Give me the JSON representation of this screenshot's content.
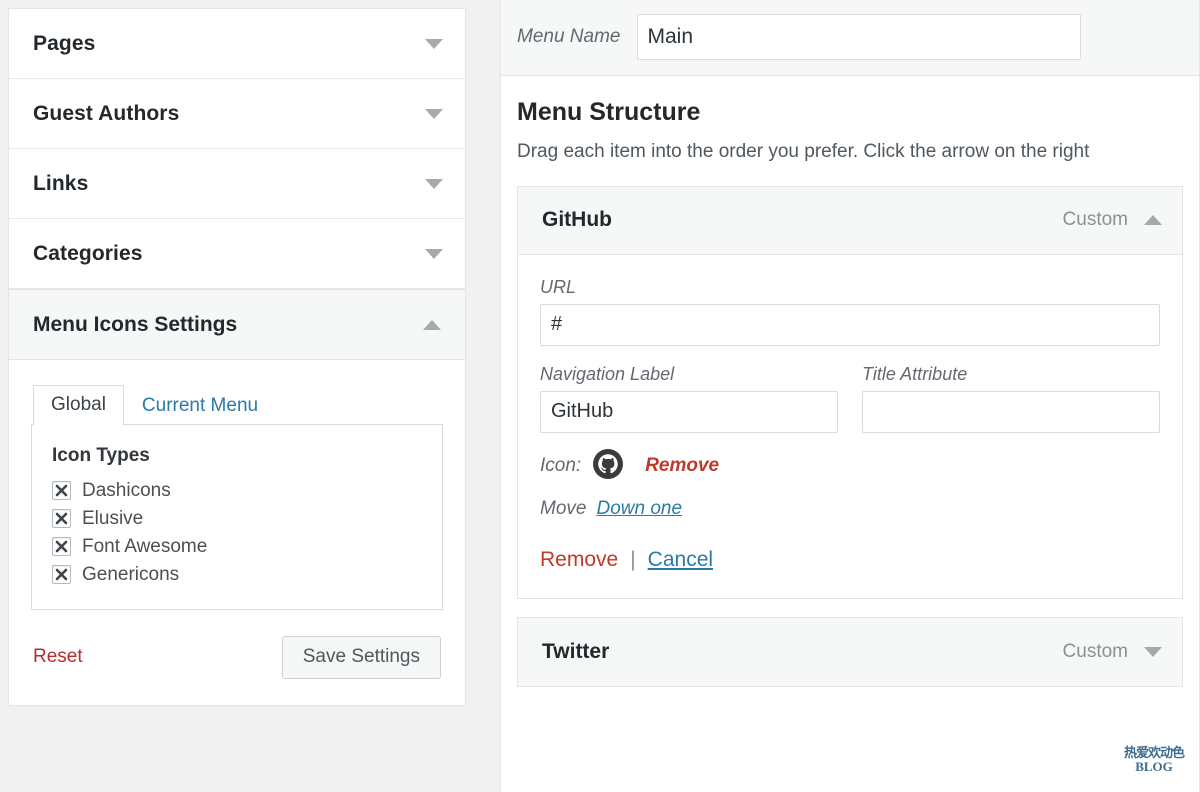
{
  "sidebar": {
    "accordions": [
      {
        "label": "Pages",
        "state": "collapsed",
        "arrow": "chevron-down-icon"
      },
      {
        "label": "Guest Authors",
        "state": "collapsed",
        "arrow": "chevron-down-icon"
      },
      {
        "label": "Links",
        "state": "collapsed",
        "arrow": "chevron-down-icon"
      },
      {
        "label": "Categories",
        "state": "collapsed",
        "arrow": "chevron-down-icon"
      }
    ],
    "menu_icons_settings": {
      "label": "Menu Icons Settings",
      "state": "expanded",
      "arrow": "chevron-up-icon",
      "tabs": [
        {
          "label": "Global",
          "active": true
        },
        {
          "label": "Current Menu",
          "active": false
        }
      ],
      "icon_types_title": "Icon Types",
      "icon_types": [
        {
          "label": "Dashicons",
          "checked": true
        },
        {
          "label": "Elusive",
          "checked": true
        },
        {
          "label": "Font Awesome",
          "checked": true
        },
        {
          "label": "Genericons",
          "checked": true
        }
      ],
      "reset_label": "Reset",
      "save_label": "Save Settings"
    }
  },
  "main": {
    "menu_name_label": "Menu Name",
    "menu_name_value": "Main",
    "structure_title": "Menu Structure",
    "structure_description": "Drag each item into the order you prefer. Click the arrow on the right",
    "items": [
      {
        "title": "GitHub",
        "type": "Custom",
        "arrow": "chevron-up-icon",
        "expanded": true,
        "url_label": "URL",
        "url_value": "#",
        "nav_label_label": "Navigation Label",
        "nav_label_value": "GitHub",
        "title_attr_label": "Title Attribute",
        "title_attr_value": "",
        "icon_label": "Icon:",
        "icon_name": "github-icon",
        "icon_remove_label": "Remove",
        "move_label": "Move",
        "move_link_label": "Down one",
        "remove_label": "Remove",
        "separator": "|",
        "cancel_label": "Cancel"
      },
      {
        "title": "Twitter",
        "type": "Custom",
        "arrow": "chevron-down-icon",
        "expanded": false
      }
    ]
  },
  "watermark": {
    "top": "热爱欢动色",
    "bottom": "BLOG"
  },
  "colors": {
    "link_blue": "#2a7aa8",
    "danger_red": "#c0392b",
    "reset_red": "#b32d2e",
    "page_bg": "#f1f1f1",
    "panel_bg": "#ffffff",
    "head_bg": "#f6f7f7",
    "border": "#e5e5e5",
    "text_dark": "#23282d",
    "text_muted": "#646970"
  }
}
